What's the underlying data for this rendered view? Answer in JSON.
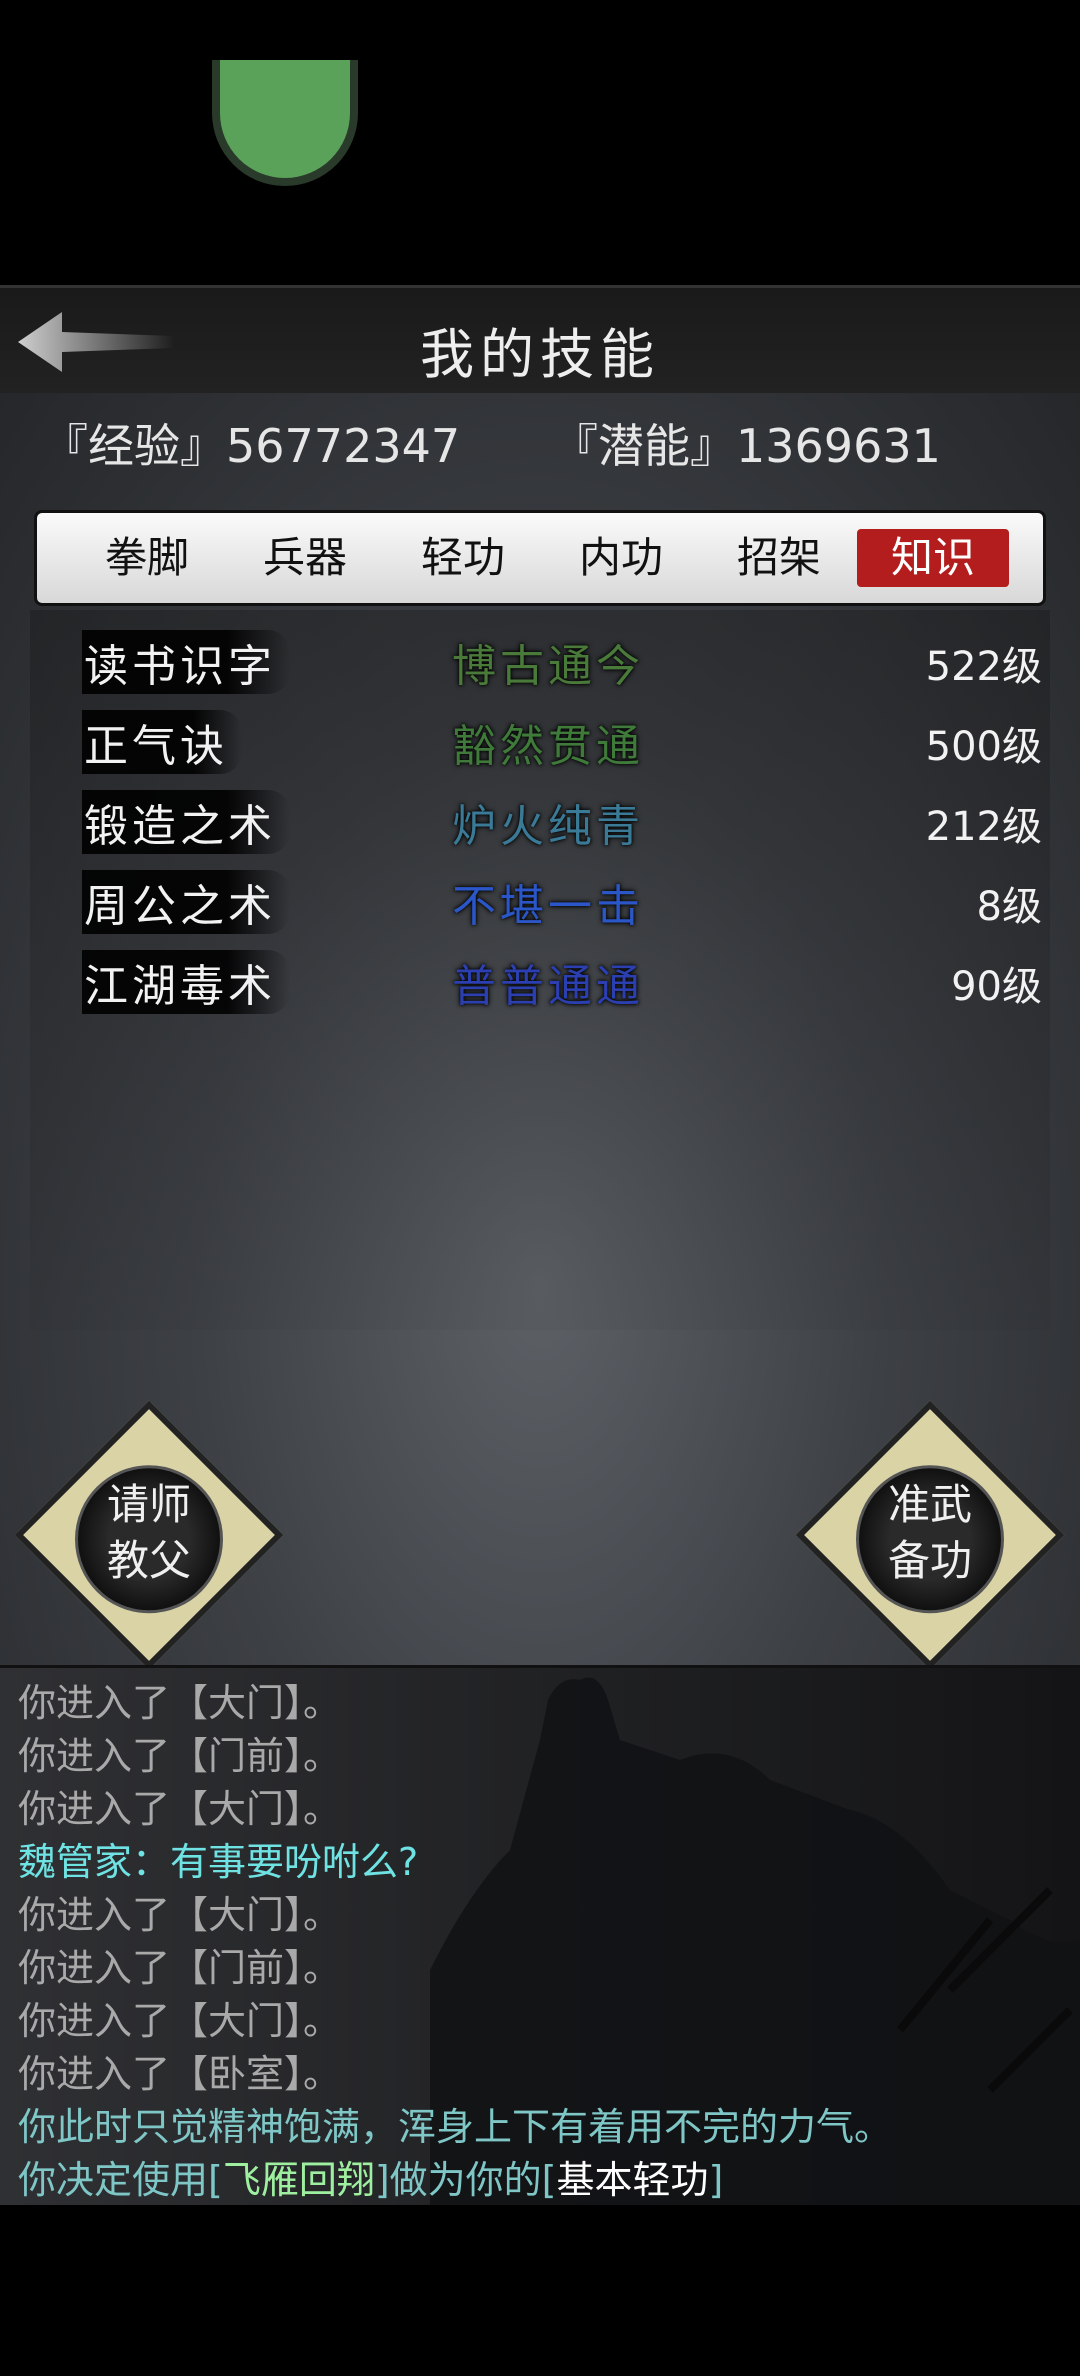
{
  "header": {
    "title": "我的技能"
  },
  "stats": {
    "experience_label": "『经验』56772347",
    "potential_label": "『潜能』1369631"
  },
  "tabs": [
    {
      "label": "拳脚",
      "active": false
    },
    {
      "label": "兵器",
      "active": false
    },
    {
      "label": "轻功",
      "active": false
    },
    {
      "label": "内功",
      "active": false
    },
    {
      "label": "招架",
      "active": false
    },
    {
      "label": "知识",
      "active": true
    }
  ],
  "skills": [
    {
      "name": "读书识字",
      "rank": "博古通今",
      "rank_color": "#4a7a3a",
      "level": "522级"
    },
    {
      "name": "正气诀",
      "rank": "豁然贯通",
      "rank_color": "#3f7a3a",
      "level": "500级"
    },
    {
      "name": "锻造之术",
      "rank": "炉火纯青",
      "rank_color": "#3a7a96",
      "level": "212级"
    },
    {
      "name": "周公之术",
      "rank": "不堪一击",
      "rank_color": "#2b56c8",
      "level": "8级"
    },
    {
      "name": "江湖毒术",
      "rank": "普普通通",
      "rank_color": "#2b3fb0",
      "level": "90级"
    }
  ],
  "buttons": {
    "teacher_line1": "请师",
    "teacher_line2": "教父",
    "prepare_line1": "准武",
    "prepare_line2": "备功"
  },
  "log": {
    "lines": [
      "你进入了【大门】。",
      "你进入了【门前】。",
      "你进入了【大门】。",
      "魏管家：有事要吩咐么?",
      "你进入了【大门】。",
      "你进入了【门前】。",
      "你进入了【大门】。",
      "你进入了【卧室】。",
      "你此时只觉精神饱满，浑身上下有着用不完的力气。"
    ],
    "last_prefix": "你决定使用[",
    "last_skill": "飞雁回翔",
    "last_mid": "]做为你的[",
    "last_type": "基本轻功",
    "last_suffix": "]"
  }
}
